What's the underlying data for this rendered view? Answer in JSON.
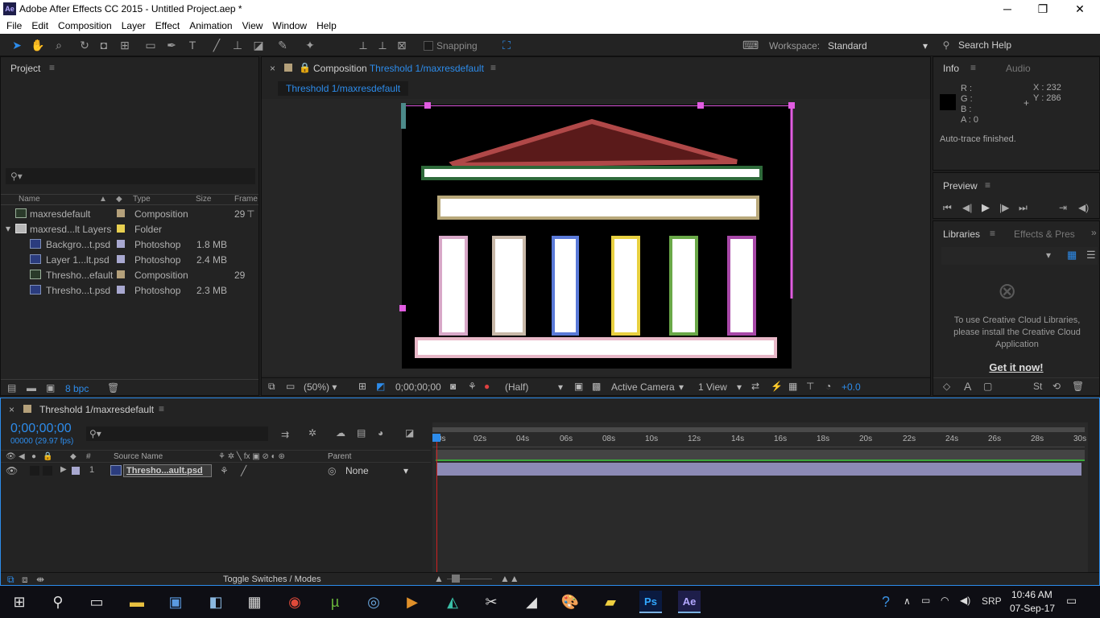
{
  "window": {
    "title": "Adobe After Effects CC 2015 - Untitled Project.aep *",
    "app_badge": "Ae",
    "minimize": "─",
    "restore": "❐",
    "close": "✕"
  },
  "menu": [
    "File",
    "Edit",
    "Composition",
    "Layer",
    "Effect",
    "Animation",
    "View",
    "Window",
    "Help"
  ],
  "toolbar": {
    "snapping": "Snapping",
    "workspace_label": "Workspace:",
    "workspace_value": "Standard",
    "search": "Search Help"
  },
  "project": {
    "title": "Project",
    "columns": {
      "name": "Name",
      "type": "Type",
      "size": "Size",
      "frame": "Frame"
    },
    "items": [
      {
        "name": "maxresdefault",
        "type": "Composition",
        "size": "",
        "frame": "29",
        "indent": 0,
        "label": "#b4a07a",
        "icon": "composition-icon"
      },
      {
        "name": "maxresd...lt Layers",
        "type": "Folder",
        "size": "",
        "frame": "",
        "indent": 0,
        "label": "#e8d050",
        "icon": "folder-icon"
      },
      {
        "name": "Backgro...t.psd",
        "type": "Photoshop",
        "size": "1.8 MB",
        "frame": "",
        "indent": 1,
        "label": "#a8a8d0",
        "icon": "photoshop-file-icon"
      },
      {
        "name": "Layer 1...lt.psd",
        "type": "Photoshop",
        "size": "2.4 MB",
        "frame": "",
        "indent": 1,
        "label": "#a8a8d0",
        "icon": "photoshop-file-icon"
      },
      {
        "name": "Thresho...efault",
        "type": "Composition",
        "size": "",
        "frame": "29",
        "indent": 1,
        "label": "#b4a07a",
        "icon": "composition-icon"
      },
      {
        "name": "Thresho...t.psd",
        "type": "Photoshop",
        "size": "2.3 MB",
        "frame": "",
        "indent": 1,
        "label": "#a8a8d0",
        "icon": "photoshop-file-icon"
      }
    ],
    "bpc": "8 bpc"
  },
  "composition": {
    "tab_prefix": "Composition",
    "tab_name": "Threshold 1/maxresdefault",
    "breadcrumb": "Threshold 1/maxresdefault",
    "footer": {
      "zoom": "(50%)",
      "timecode": "0;00;00;00",
      "resolution": "(Half)",
      "camera": "Active Camera",
      "views": "1 View",
      "exposure": "+0.0"
    }
  },
  "info": {
    "title": "Info",
    "tab2": "Audio",
    "r": "R :",
    "g": "G :",
    "b": "B :",
    "a": "A : 0",
    "x": "X : 232",
    "y": "Y : 286",
    "status": "Auto-trace finished."
  },
  "preview": {
    "title": "Preview"
  },
  "libraries": {
    "title": "Libraries",
    "tab2": "Effects & Pres",
    "message": "To use Creative Cloud Libraries, please install the Creative Cloud Application",
    "link": "Get it now!"
  },
  "timeline": {
    "tab": "Threshold 1/maxresdefault",
    "timecode": "0;00;00;00",
    "fps": "00000 (29.97 fps)",
    "ticks": [
      "0s",
      "02s",
      "04s",
      "06s",
      "08s",
      "10s",
      "12s",
      "14s",
      "16s",
      "18s",
      "20s",
      "22s",
      "24s",
      "26s",
      "28s",
      "30s"
    ],
    "columns": {
      "source": "Source Name",
      "parent": "Parent",
      "num": "#"
    },
    "layer": {
      "index": "1",
      "name": "Thresho...ault.psd",
      "parent": "None"
    },
    "toggle": "Toggle Switches / Modes"
  },
  "taskbar": {
    "time": "10:46 AM",
    "date": "07-Sep-17",
    "lang": "SRP"
  },
  "colors": {
    "accent": "#2d8ceb",
    "comp_border": "#e15ce1",
    "bar": "#8c8ab5"
  }
}
